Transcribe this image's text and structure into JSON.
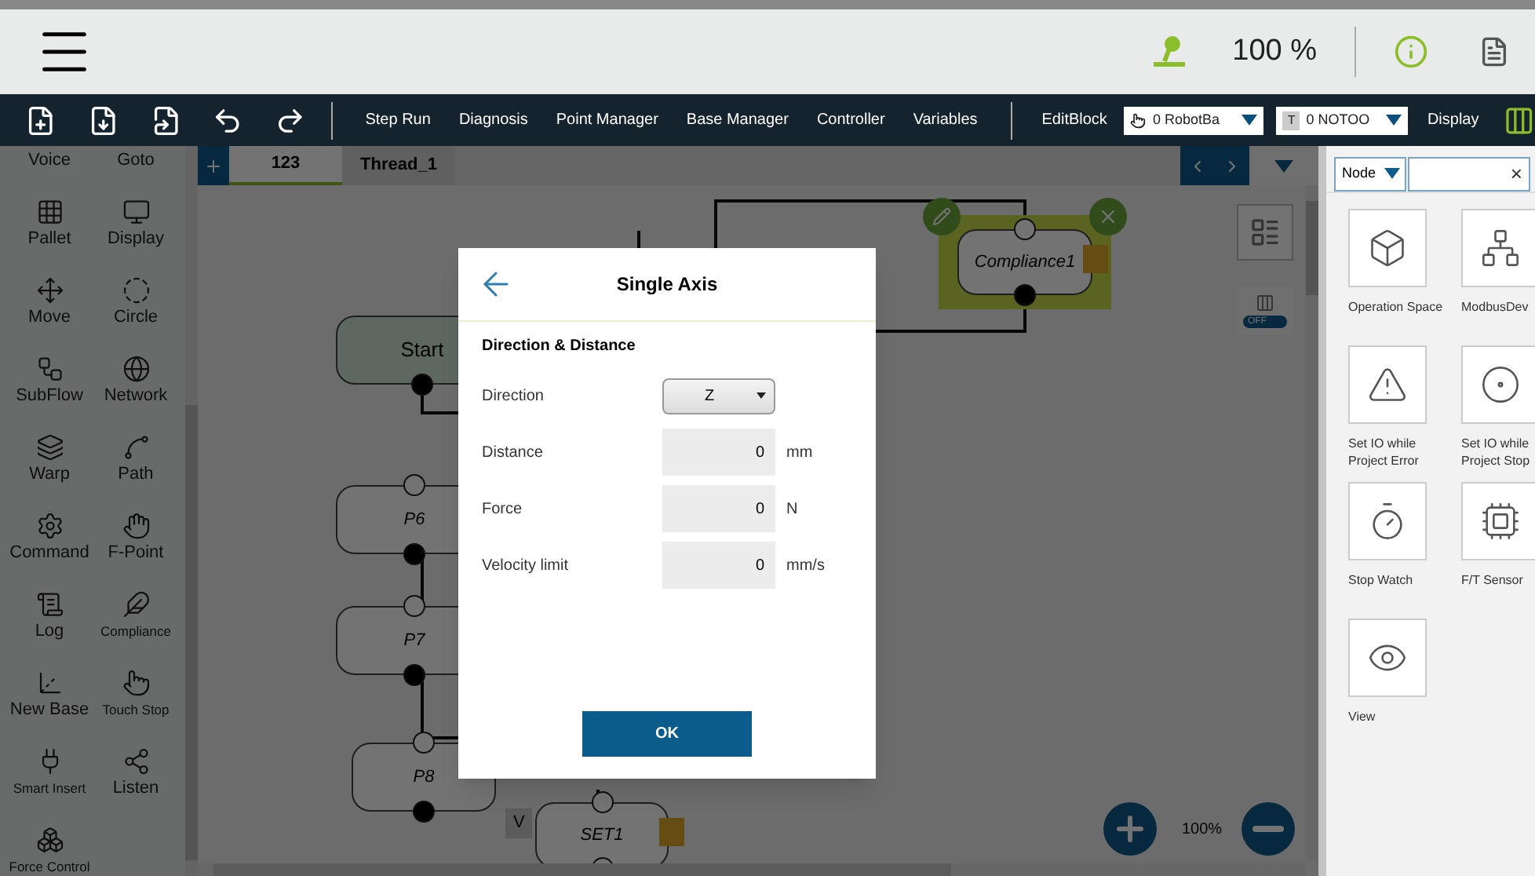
{
  "top_bar": {
    "speed": "100 %"
  },
  "toolbar": {
    "actions": [
      "Step Run",
      "Diagnosis",
      "Point Manager",
      "Base Manager",
      "Controller",
      "Variables"
    ],
    "edit_block": "EditBlock",
    "robot_base": "0 RobotBa",
    "tool_badge": "T",
    "tool": "0 NOTOO",
    "display": "Display"
  },
  "palette": [
    "Voice",
    "Goto",
    "Pallet",
    "Display",
    "Move",
    "Circle",
    "SubFlow",
    "Network",
    "Warp",
    "Path",
    "Command",
    "F-Point",
    "Log",
    "Compliance",
    "New Base",
    "Touch Stop",
    "Smart Insert",
    "Listen",
    "Force Control"
  ],
  "tabs": [
    {
      "label": "123",
      "selected": true
    },
    {
      "label": "Thread_1",
      "selected": false
    }
  ],
  "canvas": {
    "nodes": [
      {
        "label": "Start",
        "kind": "start",
        "selected": false
      },
      {
        "label": "P6",
        "kind": "point",
        "selected": false
      },
      {
        "label": "P7",
        "kind": "point",
        "selected": false
      },
      {
        "label": "P8",
        "kind": "point",
        "selected": false
      },
      {
        "label": "SET1",
        "kind": "set",
        "selected": false
      },
      {
        "label": "Compliance1",
        "kind": "compliance",
        "selected": true
      }
    ],
    "variable_badge": "V",
    "toggle": "OFF",
    "zoom": "100%"
  },
  "dialog": {
    "title": "Single Axis",
    "section": "Direction & Distance",
    "fields": [
      {
        "label": "Direction",
        "kind": "select",
        "value": "Z"
      },
      {
        "label": "Distance",
        "kind": "number",
        "value": "0",
        "unit": "mm"
      },
      {
        "label": "Force",
        "kind": "number",
        "value": "0",
        "unit": "N"
      },
      {
        "label": "Velocity limit",
        "kind": "number",
        "value": "0",
        "unit": "mm/s"
      }
    ],
    "ok": "OK"
  },
  "node_panel": {
    "filter": "Node",
    "clear": "×",
    "items": [
      "Operation Space",
      "ModbusDev",
      "Set IO while Project Error",
      "Set IO while Project Stop",
      "Stop Watch",
      "F/T Sensor",
      "View"
    ]
  }
}
